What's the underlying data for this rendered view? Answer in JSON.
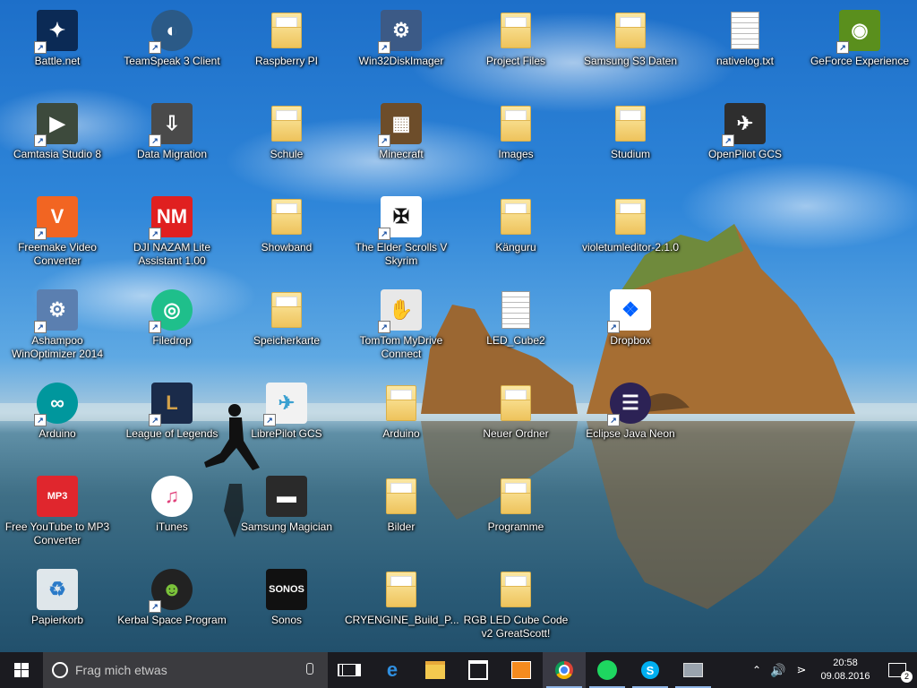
{
  "desktop": {
    "icons": [
      {
        "label": "Battle.net",
        "glyph": "battlenet-icon"
      },
      {
        "label": "TeamSpeak 3 Client",
        "glyph": "teamspeak-icon"
      },
      {
        "label": "Raspberry PI",
        "glyph": "folder-icon"
      },
      {
        "label": "Win32DiskImager",
        "glyph": "diskimager-icon"
      },
      {
        "label": "Project Files",
        "glyph": "folder-icon"
      },
      {
        "label": "Samsung S3 Daten",
        "glyph": "folder-icon"
      },
      {
        "label": "nativelog.txt",
        "glyph": "text-file-icon"
      },
      {
        "label": "GeForce Experience",
        "glyph": "geforce-icon"
      },
      {
        "label": "Camtasia Studio 8",
        "glyph": "camtasia-icon"
      },
      {
        "label": "Data Migration",
        "glyph": "data-migration-icon"
      },
      {
        "label": "Schule",
        "glyph": "folder-icon"
      },
      {
        "label": "Minecraft",
        "glyph": "minecraft-icon"
      },
      {
        "label": "Images",
        "glyph": "folder-icon"
      },
      {
        "label": "Studium",
        "glyph": "folder-icon"
      },
      {
        "label": "OpenPilot GCS",
        "glyph": "openpilot-icon"
      },
      {
        "label": "Freemake Video Converter",
        "glyph": "freemake-icon"
      },
      {
        "label": "DJI NAZAM Lite Assistant 1.00",
        "glyph": "dji-icon"
      },
      {
        "label": "Showband",
        "glyph": "folder-icon"
      },
      {
        "label": "The Elder Scrolls V Skyrim",
        "glyph": "skyrim-icon"
      },
      {
        "label": "Känguru",
        "glyph": "folder-icon"
      },
      {
        "label": "violetumleditor-2.1.0",
        "glyph": "folder-icon"
      },
      {
        "label": "Ashampoo WinOptimizer 2014",
        "glyph": "ashampoo-icon"
      },
      {
        "label": "Filedrop",
        "glyph": "filedrop-icon"
      },
      {
        "label": "Speicherkarte",
        "glyph": "folder-icon"
      },
      {
        "label": "TomTom MyDrive Connect",
        "glyph": "tomtom-icon"
      },
      {
        "label": "LED_Cube2",
        "glyph": "arduino-file-icon"
      },
      {
        "label": "Dropbox",
        "glyph": "dropbox-icon"
      },
      {
        "label": "Arduino",
        "glyph": "arduino-icon"
      },
      {
        "label": "League of Legends",
        "glyph": "lol-icon"
      },
      {
        "label": "LibrePilot GCS",
        "glyph": "librepilot-icon"
      },
      {
        "label": "Arduino",
        "glyph": "folder-icon"
      },
      {
        "label": "Neuer Ordner",
        "glyph": "folder-icon"
      },
      {
        "label": "Eclipse Java Neon",
        "glyph": "eclipse-icon"
      },
      {
        "label": "Free YouTube to MP3 Converter",
        "glyph": "mp3-icon"
      },
      {
        "label": "iTunes",
        "glyph": "itunes-icon"
      },
      {
        "label": "Samsung Magician",
        "glyph": "ssd-icon"
      },
      {
        "label": "Bilder",
        "glyph": "folder-icon"
      },
      {
        "label": "Programme",
        "glyph": "folder-icon"
      },
      {
        "label": "Papierkorb",
        "glyph": "recycle-bin-icon"
      },
      {
        "label": "Kerbal Space Program",
        "glyph": "kerbal-icon"
      },
      {
        "label": "Sonos",
        "glyph": "sonos-icon"
      },
      {
        "label": "CRYENGINE_Build_P...",
        "glyph": "folder-icon"
      },
      {
        "label": "RGB LED Cube Code v2 GreatScott!",
        "glyph": "folder-icon"
      }
    ]
  },
  "taskbar": {
    "search_placeholder": "Frag mich etwas",
    "pinned": [
      "task-view-icon",
      "edge-icon",
      "file-explorer-icon",
      "store-icon",
      "media-player-icon",
      "chrome-icon",
      "spotify-icon",
      "skype-icon",
      "network-drive-icon"
    ],
    "time": "20:58",
    "date": "09.08.2016",
    "notification_count": "2"
  },
  "colors": {
    "taskbar": "#1b1b20",
    "search_box": "#3b3b3f",
    "folder": "#f2cf6c"
  }
}
